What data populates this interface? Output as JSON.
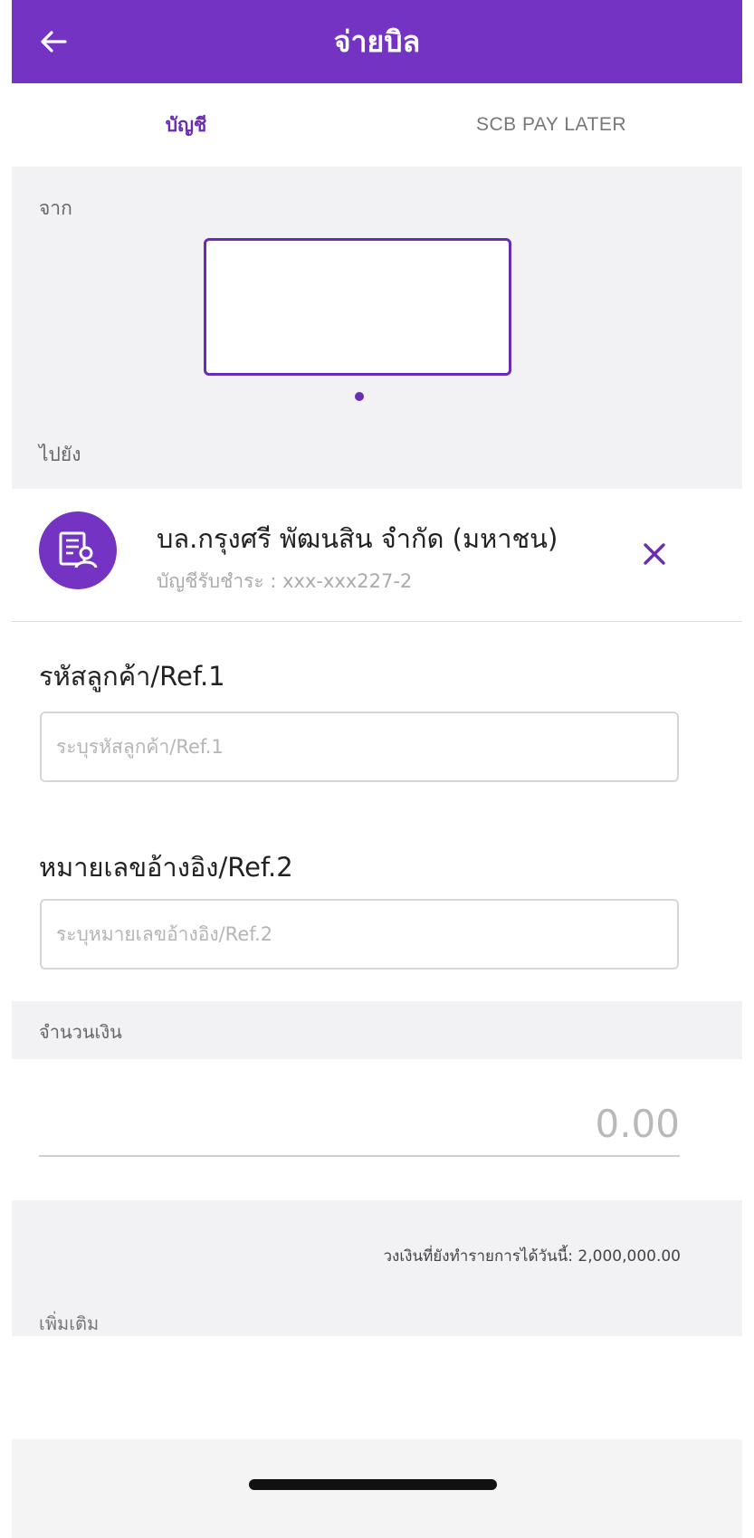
{
  "header": {
    "title": "จ่ายบิล",
    "back_icon": "arrow-left-icon"
  },
  "tabs": [
    {
      "label": "บัญชี",
      "active": true
    },
    {
      "label": "SCB PAY LATER",
      "active": false
    }
  ],
  "from": {
    "label": "จาก"
  },
  "to": {
    "label": "ไปยัง"
  },
  "payee": {
    "name": "บล.กรุงศรี พัฒนสิน จำกัด (มหาชน)",
    "account": "บัญชีรับชำระ : xxx-xxx227-2",
    "icon": "bill-profile-icon",
    "remove_icon": "close-icon"
  },
  "ref1": {
    "label": "รหัสลูกค้า/Ref.1",
    "placeholder": "ระบุรหัสลูกค้า/Ref.1"
  },
  "ref2": {
    "label": "หมายเลขอ้างอิง/Ref.2",
    "placeholder": "ระบุหมายเลขอ้างอิง/Ref.2"
  },
  "amount": {
    "label": "จำนวนเงิน",
    "placeholder": "0.00"
  },
  "limit": {
    "text": "วงเงินที่ยังทำรายการได้วันนี้: 2,000,000.00"
  },
  "more": {
    "label": "เพิ่มเติม"
  },
  "colors": {
    "primary": "#7433c2",
    "accent": "#6a2bb5",
    "section_bg": "#f2f2f4"
  }
}
